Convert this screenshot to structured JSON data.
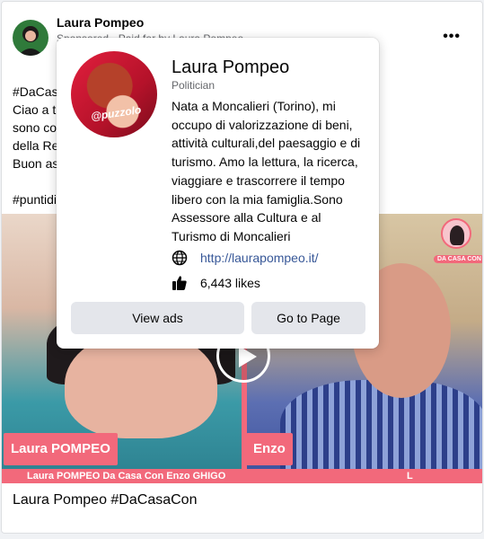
{
  "post": {
    "author": "Laura Pompeo",
    "sponsored": "Sponsored · Paid for by Laura Pompeo",
    "more_label": "•••",
    "text_lines": [
      "#DaCasa",
      "Ciao a tu",
      "sono co                                                              già Presidente",
      "della Re",
      "Buon as",
      "",
      "#puntidi"
    ],
    "caption": "Laura Pompeo #DaCasaCon"
  },
  "video": {
    "left_name": "Laura POMPEO",
    "right_name": "Enzo",
    "ticker": "Laura POMPEO Da Casa Con Enzo GHIGO                                                                  L",
    "logo_text": "DA CASA CON"
  },
  "hovercard": {
    "name": "Laura Pompeo",
    "role": "Politician",
    "bio_lines": [
      "Nata a Moncalieri (Torino), mi",
      "occupo di valorizzazione di beni,",
      "attività culturali,del paesaggio e di",
      "turismo. Amo la lettura, la ricerca,",
      "viaggiare e trascorrere il tempo",
      "libero con la mia famiglia.Sono",
      "Assessore alla Cultura e al",
      "Turismo di Moncalieri"
    ],
    "website": "http://laurapompeo.it/",
    "likes": "6,443 likes",
    "avatar_tag": "@puzzolo",
    "view_ads_label": "View ads",
    "go_to_page_label": "Go to Page"
  }
}
